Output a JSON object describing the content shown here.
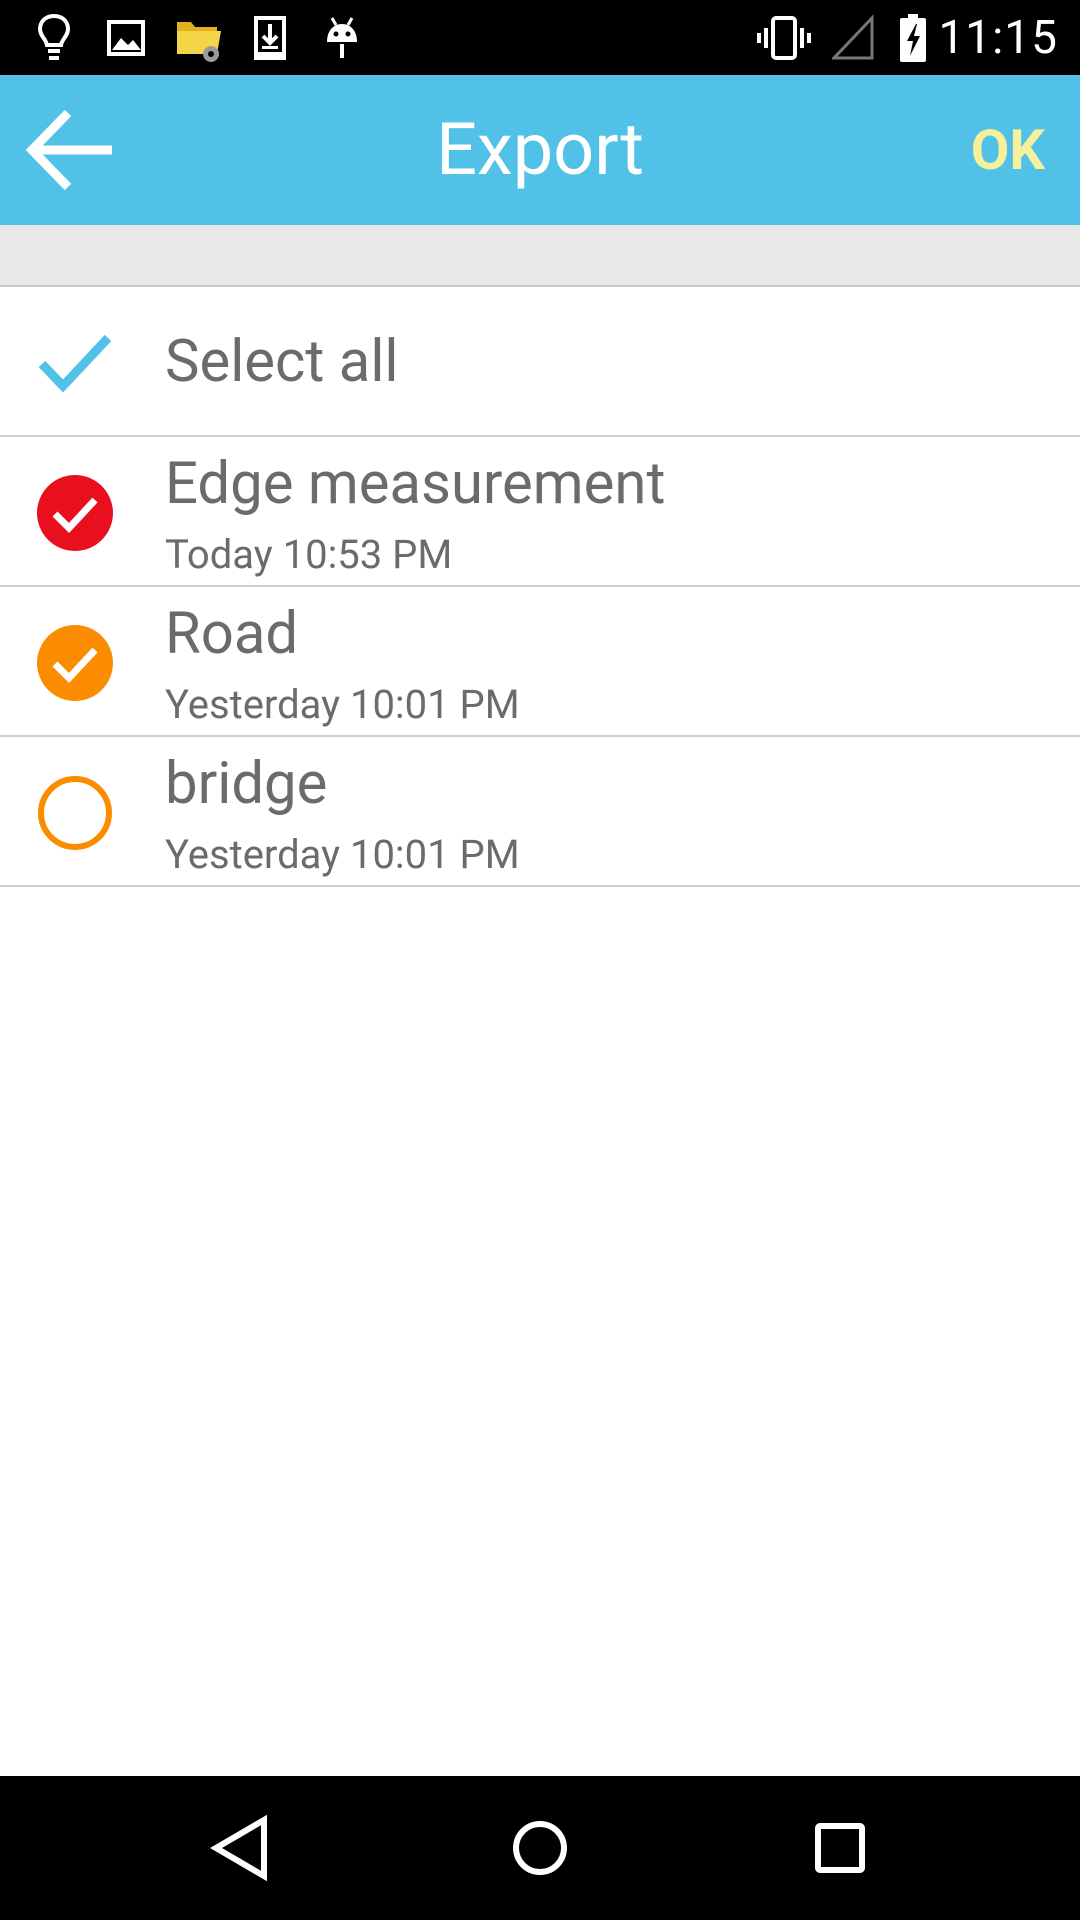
{
  "status_bar": {
    "time": "11:15",
    "left_icons": [
      "lightbulb-icon",
      "image-icon",
      "folder-settings-icon",
      "download-icon",
      "android-icon"
    ],
    "right_icons": [
      "vibrate-icon",
      "signal-icon",
      "battery-charging-icon"
    ]
  },
  "app_bar": {
    "title": "Export",
    "ok_label": "OK",
    "back_icon": "arrow-left-icon",
    "bg_color": "#52c1e7",
    "ok_color": "#f6ef9c"
  },
  "select_all": {
    "label": "Select all",
    "checked": true,
    "icon": "checkmark-icon",
    "color": "#52c1e7"
  },
  "items": [
    {
      "title": "Edge measurement",
      "subtitle": "Today 10:53 PM",
      "checked": true,
      "color": "#e8101f"
    },
    {
      "title": "Road",
      "subtitle": "Yesterday 10:01 PM",
      "checked": true,
      "color": "#fb8c00"
    },
    {
      "title": "bridge",
      "subtitle": "Yesterday 10:01 PM",
      "checked": false,
      "color": "#fb8c00"
    }
  ],
  "nav_bar": {
    "buttons": [
      "back-triangle-icon",
      "home-circle-icon",
      "recents-square-icon"
    ]
  }
}
